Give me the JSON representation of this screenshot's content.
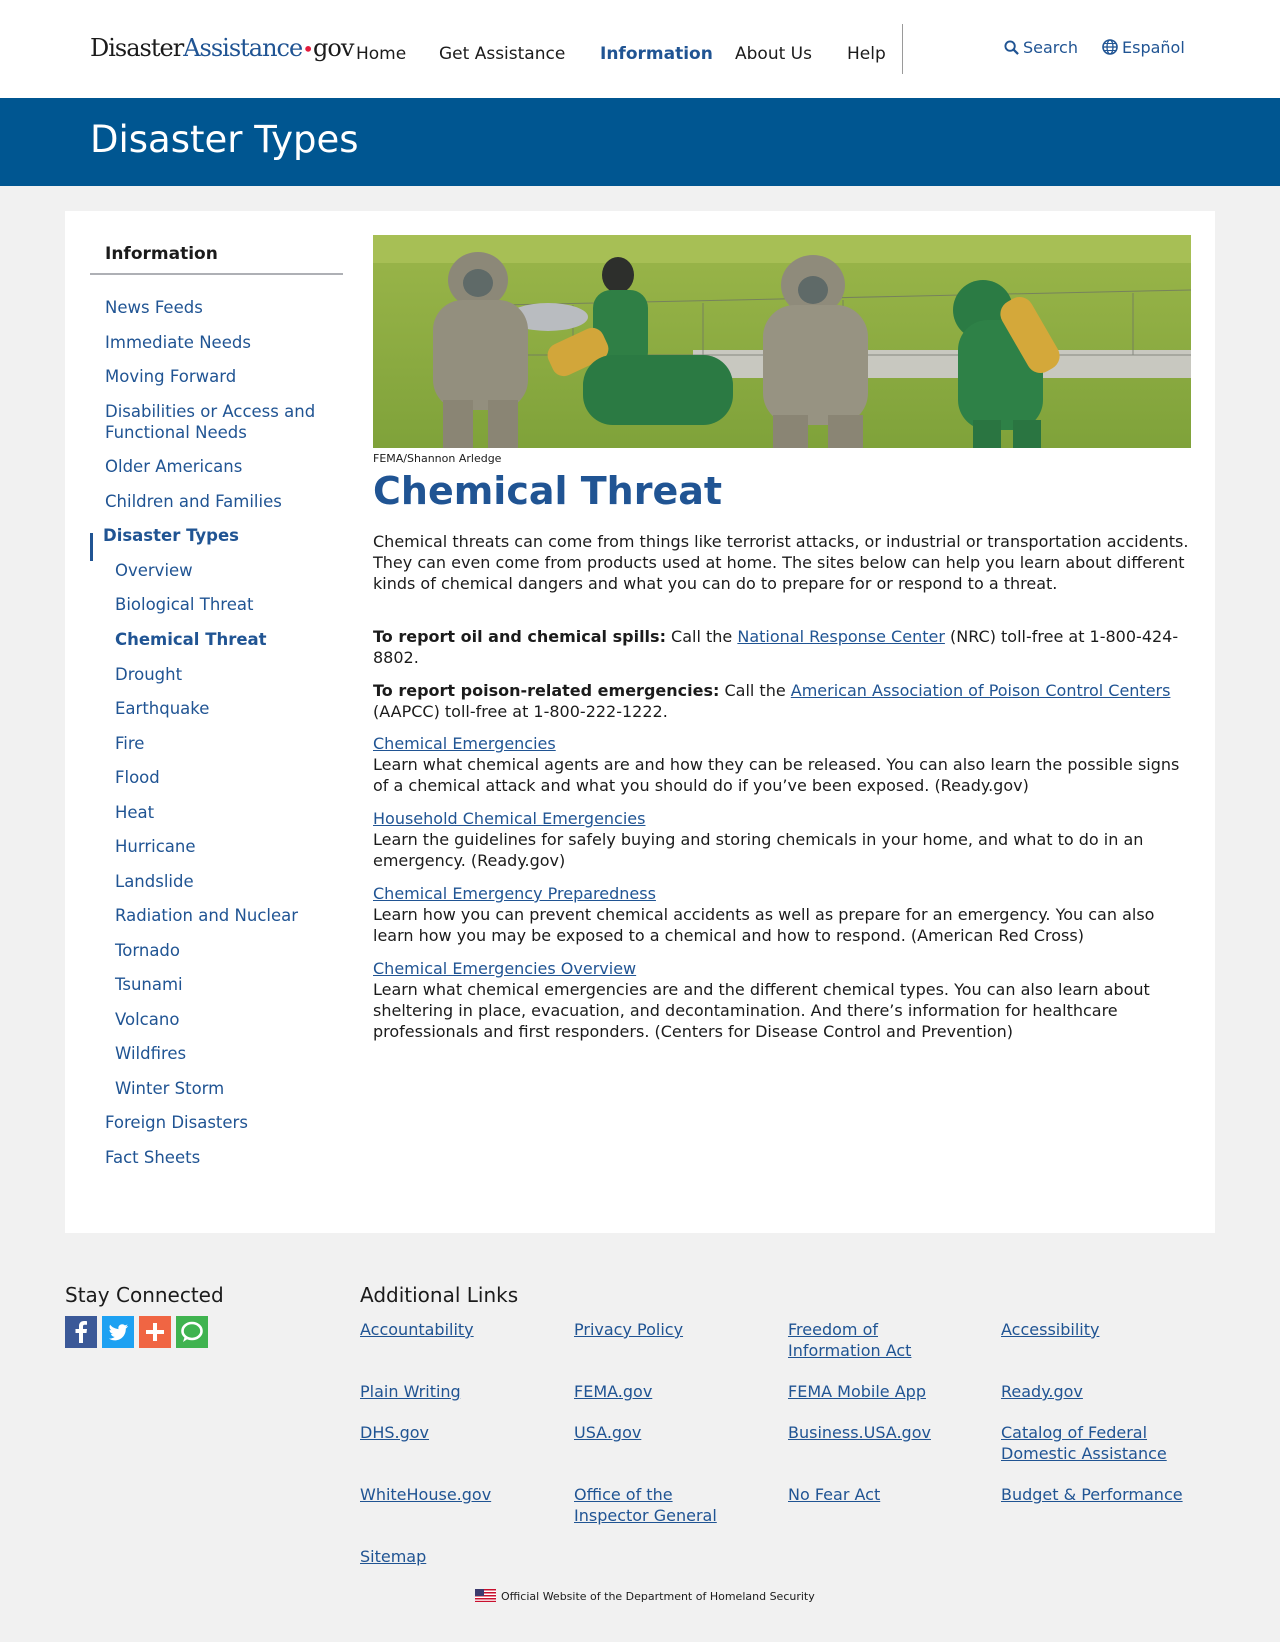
{
  "header": {
    "logo": {
      "part1": "Disaster",
      "part2": "Assistance",
      "dot": "•",
      "part3": "gov"
    },
    "nav": [
      "Home",
      "Get Assistance",
      "Information",
      "About Us",
      "Help"
    ],
    "active_nav": "Information",
    "search_label": "Search",
    "language_label": "Español"
  },
  "banner": {
    "title": "Disaster Types"
  },
  "sidenav": {
    "heading": "Information",
    "items_top": [
      "News Feeds",
      "Immediate Needs",
      "Moving Forward",
      "Disabilities or Access and Functional Needs",
      "Older Americans",
      "Children and Families"
    ],
    "current_parent": "Disaster Types",
    "sub_items": [
      "Overview",
      "Biological Threat",
      "Chemical Threat",
      "Drought",
      "Earthquake",
      "Fire",
      "Flood",
      "Heat",
      "Hurricane",
      "Landslide",
      "Radiation and Nuclear",
      "Tornado",
      "Tsunami",
      "Volcano",
      "Wildfires",
      "Winter Storm"
    ],
    "current_item": "Chemical Threat",
    "items_bottom": [
      "Foreign Disasters",
      "Fact Sheets"
    ]
  },
  "content": {
    "photo_credit": "FEMA/Shannon Arledge",
    "title": "Chemical Threat",
    "intro": "Chemical threats can come from things like terrorist attacks, or industrial or transportation accidents. They can even come from products used at home. The sites below can help you learn about different kinds of chemical dangers and what you can do to prepare for or respond to a threat.",
    "oil_label": "To report oil and chemical spills:",
    "oil_pre": " Call the ",
    "oil_link": "National Response Center",
    "oil_post": " (NRC) toll-free at 1-800-424-8802.",
    "poison_label": "To report poison-related emergencies:",
    "poison_pre": " Call the ",
    "poison_link": "American Association of Poison Control Centers",
    "poison_post": " (AAPCC) toll-free at 1-800-222-1222.",
    "resources": [
      {
        "title": "Chemical Emergencies",
        "desc": "Learn what chemical agents are and how they can be released. You can also learn the possible signs of a chemical attack and what you should do if you’ve been exposed. (Ready.gov)"
      },
      {
        "title": "Household Chemical Emergencies",
        "desc": "Learn the guidelines for safely buying and storing chemicals in your home, and what to do in an emergency. (Ready.gov)"
      },
      {
        "title": "Chemical Emergency Preparedness",
        "desc": "Learn how you can prevent chemical accidents as well as prepare for an emergency. You can also learn how you may be exposed to a chemical and how to respond. (American Red Cross)"
      },
      {
        "title": "Chemical Emergencies Overview",
        "desc": "Learn what chemical emergencies are and the different chemical types. You can also learn about sheltering in place, evacuation, and decontamination. And there’s information for healthcare professionals and first responders. (Centers for Disease Control and Prevention)"
      }
    ]
  },
  "footer": {
    "stay_connected": "Stay Connected",
    "social": [
      "facebook-icon",
      "twitter-icon",
      "share-plus-icon",
      "chat-icon"
    ],
    "additional_links_heading": "Additional Links",
    "links": [
      "Accountability",
      "Privacy Policy",
      "Freedom of Information Act",
      "Accessibility",
      "Plain Writing",
      "FEMA.gov",
      "FEMA Mobile App",
      "Ready.gov",
      "DHS.gov",
      "USA.gov",
      "Business.USA.gov",
      "Catalog of Federal Domestic Assistance",
      "WhiteHouse.gov",
      "Office of the Inspector General",
      "No Fear Act",
      "Budget & Performance",
      "Sitemap"
    ],
    "official": "Official Website of the Department of Homeland Security"
  },
  "colors": {
    "brand_blue": "#005691",
    "link_blue": "#205493",
    "alert_red": "#e31c3d"
  }
}
